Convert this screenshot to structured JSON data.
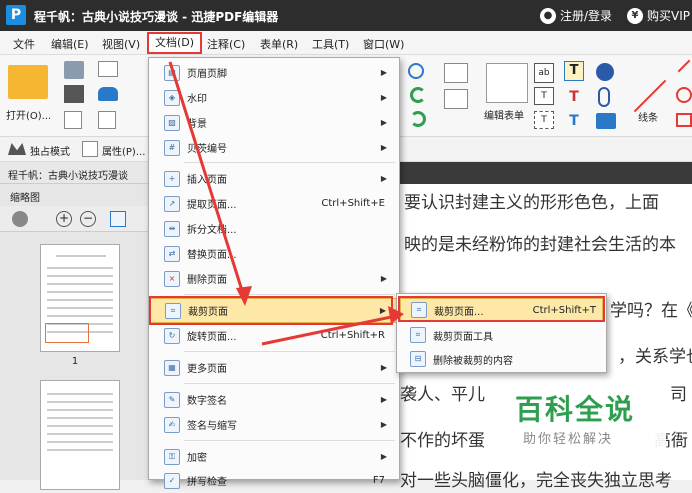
{
  "titlebar": {
    "title": "程千帆：古典小说技巧漫谈 - 迅捷PDF编辑器",
    "login": "注册/登录",
    "buy": "购买VIP"
  },
  "menubar": {
    "items": [
      "文件",
      "编辑(E)",
      "视图(V)",
      "文档(D)",
      "注释(C)",
      "表单(R)",
      "工具(T)",
      "窗口(W)"
    ]
  },
  "toolbar": {
    "open": "打开(O)...",
    "edit_form": "编辑表单",
    "line": "线条",
    "exclusive": "独占模式",
    "properties": "属性(P)..."
  },
  "docpath": "程千帆：古典小说技巧漫谈",
  "thumbs": {
    "header": "缩略图",
    "page1": "1"
  },
  "content": {
    "lines": [
      "要认识封建主义的形形色色，上面",
      "映的是未经粉饰的封建社会生活的本",
      "学吗？在《",
      "，关系学也",
      "袭人、平儿",
      "司",
      "不作的坏蛋",
      "高衙",
      "对一些头脑僵化，完全丧失独立思考"
    ]
  },
  "watermark": {
    "logo": "百科全说",
    "sub": "助你轻松解决"
  },
  "doc_menu": {
    "items": [
      {
        "label": "页眉页脚",
        "shortcut": "",
        "arrow": true
      },
      {
        "label": "水印",
        "shortcut": "",
        "arrow": true
      },
      {
        "label": "背景",
        "shortcut": "",
        "arrow": true
      },
      {
        "label": "贝茨编号",
        "shortcut": "",
        "arrow": true
      },
      {
        "label": "插入页面",
        "shortcut": "",
        "arrow": true
      },
      {
        "label": "提取页面...",
        "shortcut": "Ctrl+Shift+E",
        "arrow": false
      },
      {
        "label": "拆分文档...",
        "shortcut": "",
        "arrow": false
      },
      {
        "label": "替换页面...",
        "shortcut": "",
        "arrow": false
      },
      {
        "label": "删除页面",
        "shortcut": "",
        "arrow": true
      },
      {
        "label": "裁剪页面",
        "shortcut": "",
        "arrow": true
      },
      {
        "label": "旋转页面...",
        "shortcut": "Ctrl+Shift+R",
        "arrow": false
      },
      {
        "label": "更多页面",
        "shortcut": "",
        "arrow": true
      },
      {
        "label": "数字签名",
        "shortcut": "",
        "arrow": true
      },
      {
        "label": "签名与缩写",
        "shortcut": "",
        "arrow": true
      },
      {
        "label": "加密",
        "shortcut": "",
        "arrow": true
      },
      {
        "label": "拼写检查",
        "shortcut": "F7",
        "arrow": false
      }
    ]
  },
  "crop_submenu": {
    "items": [
      {
        "label": "裁剪页面...",
        "shortcut": "Ctrl+Shift+T"
      },
      {
        "label": "裁剪页面工具",
        "shortcut": ""
      },
      {
        "label": "删除被裁剪的内容",
        "shortcut": ""
      }
    ]
  },
  "colors": {
    "accent_red": "#e53935",
    "highlight": "#fde8a8",
    "watermark_green": "#2e9e4f"
  }
}
